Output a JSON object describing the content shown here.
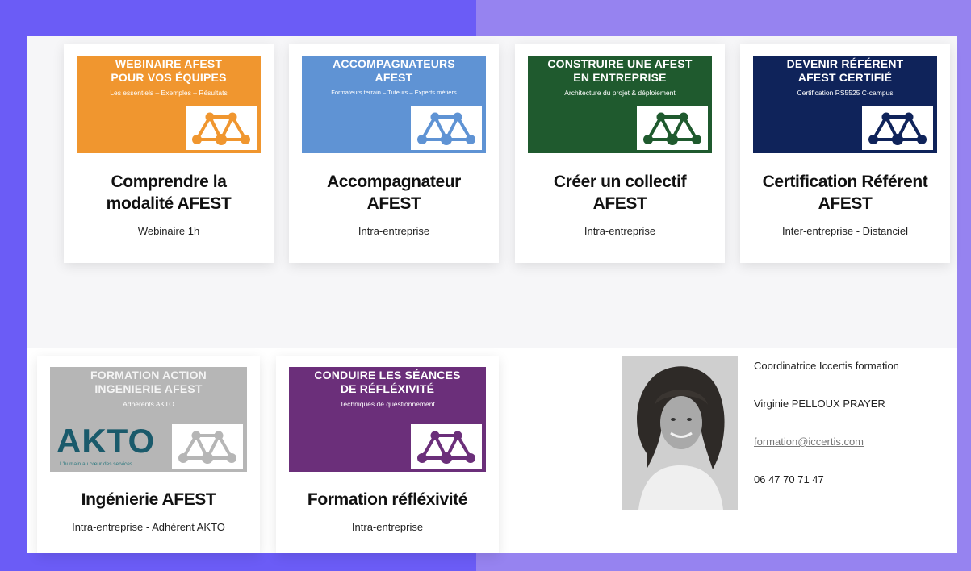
{
  "colors": {
    "orange": "#f0962f",
    "light_blue": "#5f93d4",
    "dark_green": "#1f5a2e",
    "navy": "#0f235a",
    "gray": "#b6b6b6",
    "purple": "#6b2f7a"
  },
  "cards": [
    {
      "banner_title": "WEBINAIRE AFEST\nPOUR VOS ÉQUIPES",
      "banner_subtitle": "Les essentiels – Exemples – Résultats",
      "title": "Comprendre la\nmodalité AFEST",
      "subtitle": "Webinaire 1h"
    },
    {
      "banner_title": "ACCOMPAGNATEURS\nAFEST",
      "banner_subtitle": "Formateurs terrain – Tuteurs – Experts métiers",
      "title": "Accompagnateur\nAFEST",
      "subtitle": "Intra-entreprise"
    },
    {
      "banner_title": "CONSTRUIRE UNE AFEST\nEN ENTREPRISE",
      "banner_subtitle": "Architecture du projet & déploiement",
      "title": "Créer un collectif\nAFEST",
      "subtitle": "Intra-entreprise"
    },
    {
      "banner_title": "DEVENIR RÉFÉRENT\nAFEST CERTIFIÉ",
      "banner_subtitle": "Certification RS5525 C-campus",
      "title": "Certification Référent\nAFEST",
      "subtitle": "Inter-entreprise - Distanciel"
    },
    {
      "banner_title": "FORMATION ACTION\nINGENIERIE AFEST",
      "banner_subtitle": "Adhérents AKTO",
      "akto_logo": "AKTO",
      "akto_tagline": "L'humain au cœur des services",
      "title": "Ingénierie AFEST",
      "subtitle": "Intra-entreprise - Adhérent AKTO"
    },
    {
      "banner_title": "CONDUIRE LES SÉANCES\nDE RÉFLÉXIVITÉ",
      "banner_subtitle": "Techniques de questionnement",
      "title": "Formation réfléxivité",
      "subtitle": "Intra-entreprise"
    }
  ],
  "contact": {
    "role": "Coordinatrice Iccertis formation",
    "name": "Virginie PELLOUX PRAYER",
    "email": "formation@iccertis.com",
    "phone": "06 47 70 71 47"
  }
}
